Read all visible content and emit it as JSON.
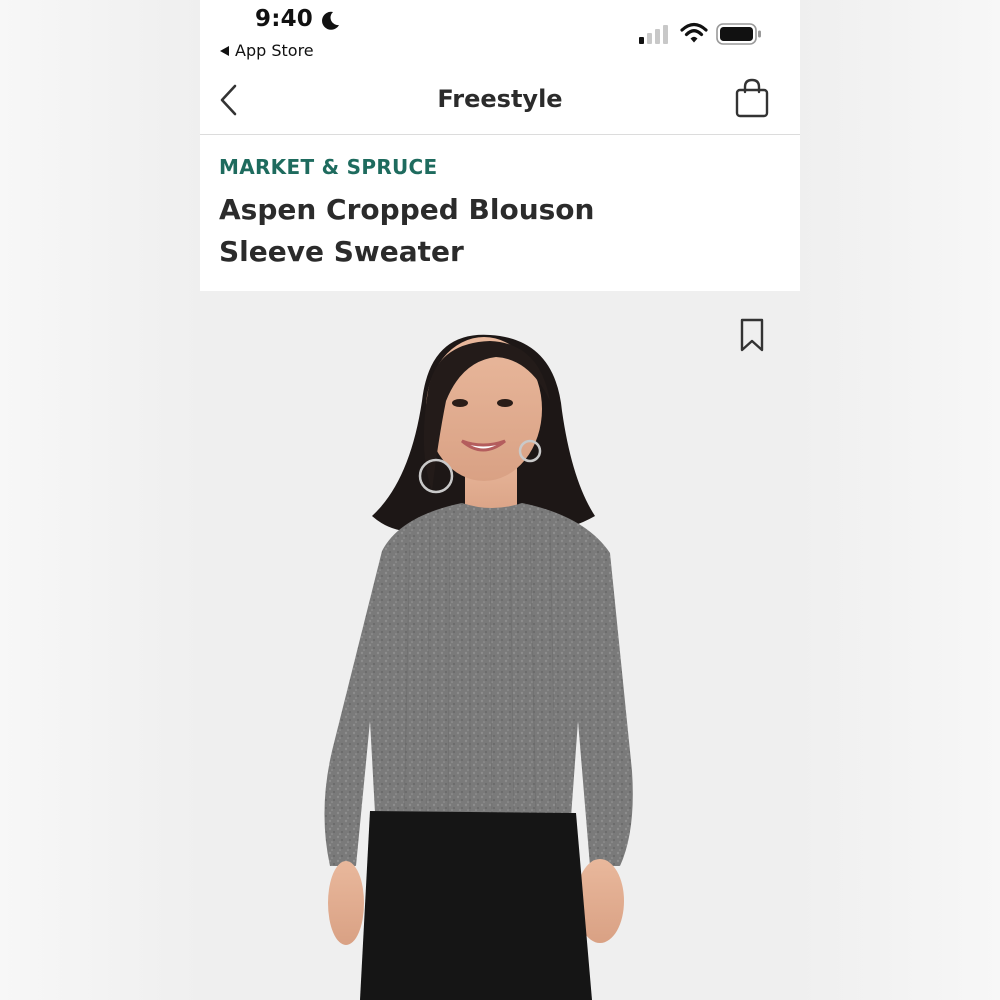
{
  "status_bar": {
    "time": "9:40",
    "back_app_label": "App Store",
    "icons": [
      "moon-icon",
      "signal-icon",
      "wifi-icon",
      "battery-icon"
    ]
  },
  "nav": {
    "title": "Freestyle",
    "back_icon": "chevron-left-icon",
    "bag_icon": "shopping-bag-icon"
  },
  "product": {
    "brand": "MARKET & SPRUCE",
    "title_line1": "Aspen Cropped Blouson",
    "title_line2": "Sleeve Sweater",
    "bookmark_icon": "bookmark-icon"
  },
  "colors": {
    "brand_accent": "#1e6b5e",
    "text_primary": "#2b2b2b",
    "image_background": "#efefef"
  }
}
